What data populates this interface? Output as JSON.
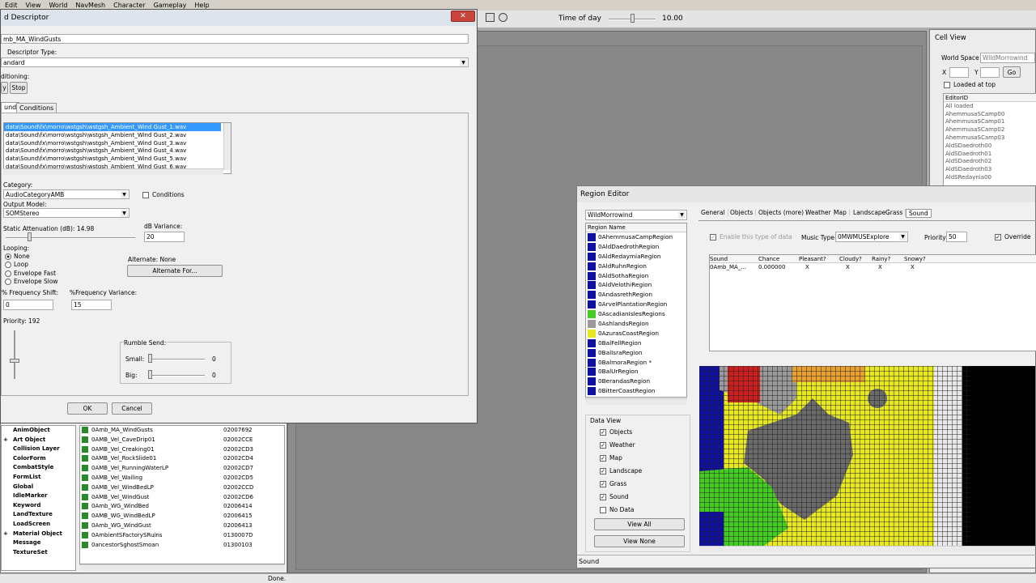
{
  "menu": [
    "Edit",
    "View",
    "World",
    "NavMesh",
    "Character",
    "Gameplay",
    "Help"
  ],
  "toolbar": {
    "time_label": "Time of day",
    "time_value": "10.00"
  },
  "descriptor": {
    "title": "d Descriptor",
    "id_value": "mb_MA_WindGusts",
    "type_label": "Descriptor Type:",
    "type_value": "andard",
    "positioning_label": "ditioning:",
    "play_label": "y",
    "stop_label": "Stop",
    "tabs": [
      "und",
      "Conditions"
    ],
    "files": [
      "data\\Sound\\fx\\morro\\wstgsh\\wstgsh_Ambient_Wind Gust_1.wav",
      "data\\Sound\\fx\\morro\\wstgsh\\wstgsh_Ambient_Wind Gust_2.wav",
      "data\\Sound\\fx\\morro\\wstgsh\\wstgsh_Ambient_Wind Gust_3.wav",
      "data\\Sound\\fx\\morro\\wstgsh\\wstgsh_Ambient_Wind Gust_4.wav",
      "data\\Sound\\fx\\morro\\wstgsh\\wstgsh_Ambient_Wind Gust_5.wav",
      "data\\Sound\\fx\\morro\\wstgsh\\wstgsh_Ambient_Wind Gust_6.wav"
    ],
    "category_label": "Category:",
    "category_value": "AudioCategoryAMB",
    "conditions_label": "Conditions",
    "output_label": "Output Model:",
    "output_value": "SOMStereo",
    "static_att_label": "Static Attenuation (dB): 14.98",
    "static_att_value": 0.18,
    "variance_label": "dB Variance:",
    "variance_value": "20",
    "looping_label": "Looping:",
    "loop_options": [
      "None",
      "Loop",
      "Envelope Fast",
      "Envelope Slow"
    ],
    "loop_selected": 0,
    "alternate_label": "Alternate:  None",
    "alternate_btn": "Alternate For...",
    "freq_shift_label": "% Frequency Shift:",
    "freq_shift_value": "0",
    "freq_var_label": "%Frequency Variance:",
    "freq_var_value": "15",
    "priority_label": "Priority:  192",
    "rumble_label": "Rumble Send:",
    "small_label": "Small:",
    "small_value": "0",
    "big_label": "Big:",
    "big_value": "0",
    "ok": "OK",
    "cancel": "Cancel"
  },
  "object_tree": [
    "AnimObject",
    "Art Object",
    "Collision Layer",
    "ColorForm",
    "CombatStyle",
    "FormList",
    "Global",
    "IdleMarker",
    "Keyword",
    "LandTexture",
    "LoadScreen",
    "Material Object",
    "Message",
    "TextureSet"
  ],
  "object_list": [
    {
      "name": "0Amb_MA_WindGusts",
      "id": "02007692"
    },
    {
      "name": "0AMB_Vel_CaveDrip01",
      "id": "02002CCE"
    },
    {
      "name": "0AMB_Vel_Creaking01",
      "id": "02002CD3"
    },
    {
      "name": "0AMB_Vel_RockSlide01",
      "id": "02002CD4"
    },
    {
      "name": "0AMB_Vel_RunningWaterLP",
      "id": "02002CD7"
    },
    {
      "name": "0AMB_Vel_Wailing",
      "id": "02002CD5"
    },
    {
      "name": "0AMB_Vel_WindBedLP",
      "id": "02002CCD"
    },
    {
      "name": "0AMB_Vel_WindGust",
      "id": "02002CD6"
    },
    {
      "name": "0Amb_WG_WindBed",
      "id": "02006414"
    },
    {
      "name": "0AMB_WG_WindBedLP",
      "id": "02006415"
    },
    {
      "name": "0Amb_WG_WindGust",
      "id": "02006413"
    },
    {
      "name": "0AmbientSFactorySRuins",
      "id": "0130007D"
    },
    {
      "name": "0ancestorSghostSmoan",
      "id": "01300103"
    }
  ],
  "status": {
    "done": "Done."
  },
  "cell_view": {
    "title": "Cell View",
    "world_space_label": "World Space",
    "world_space_value": "WildMorrowind",
    "x_label": "X",
    "y_label": "Y",
    "go": "Go",
    "loaded_label": "Loaded at top",
    "editor_header": "EditorID",
    "cells": [
      "All loaded",
      "AhemmusaSCamp00",
      "AhemmusaSCamp01",
      "AhemmusaSCamp02",
      "AhemmusaSCamp03",
      "AldSDaedroth00",
      "AldSDaedroth01",
      "AldSDaedroth02",
      "AldSDaedroth03",
      "AldSRedaynia00"
    ]
  },
  "region_editor": {
    "title": "Region Editor",
    "world_value": "WildMorrowind",
    "tabs": [
      "General",
      "Objects",
      "Objects (more)",
      "Weather",
      "Map",
      "Landscape",
      "Grass",
      "Sound"
    ],
    "region_header": "Region Name",
    "regions": [
      {
        "name": "0AhemmusaCampRegion",
        "color": "#1010a0"
      },
      {
        "name": "0AldDaedrothRegion",
        "color": "#1010a0"
      },
      {
        "name": "0AldRedaymiaRegion",
        "color": "#1010a0"
      },
      {
        "name": "0AldRuhnRegion",
        "color": "#1010a0"
      },
      {
        "name": "0AldSothaRegion",
        "color": "#1010a0"
      },
      {
        "name": "0AldVelothiRegion",
        "color": "#1010a0"
      },
      {
        "name": "0AndasrethRegion",
        "color": "#1010a0"
      },
      {
        "name": "0ArvelPlantationRegion",
        "color": "#1010a0"
      },
      {
        "name": "0AscadianIslesRegions",
        "color": "#44cc22"
      },
      {
        "name": "0AshlandsRegion",
        "color": "#9a9a9a"
      },
      {
        "name": "0AzurasCoastRegion",
        "color": "#e8e820"
      },
      {
        "name": "0BalFellRegion",
        "color": "#1010a0"
      },
      {
        "name": "0BalIsraRegion",
        "color": "#1010a0"
      },
      {
        "name": "0BalmoraRegion *",
        "color": "#1010a0"
      },
      {
        "name": "0BalUrRegion",
        "color": "#1010a0"
      },
      {
        "name": "0BerandasRegion",
        "color": "#1010a0"
      },
      {
        "name": "0BitterCoastRegion",
        "color": "#1010a0"
      }
    ],
    "enable_label": "Enable this type of data",
    "music_label": "Music Type",
    "music_value": "0MWMUSExplore",
    "priority_label": "Priority:",
    "priority_value": "50",
    "override_label": "Override",
    "table_headers": [
      "Sound",
      "Chance",
      "Pleasant?",
      "Cloudy?",
      "Rainy?",
      "Snowy?"
    ],
    "table_rows": [
      [
        "0Amb_MA_...",
        "0.000000",
        "X",
        "X",
        "X",
        "X"
      ]
    ],
    "data_view_label": "Data View",
    "data_view": [
      "Objects",
      "Weather",
      "Map",
      "Landscape",
      "Grass",
      "Sound",
      "No Data"
    ],
    "data_view_checked": [
      true,
      true,
      true,
      true,
      true,
      true,
      false
    ],
    "view_all": "View All",
    "view_none": "View None",
    "status": "Sound"
  },
  "colors": {
    "blue": "#1010a0",
    "green": "#44cc22",
    "gray": "#7a7a7a",
    "yellow": "#e8e820",
    "red": "#cc2020",
    "white": "#e8e8e8",
    "black": "#000000"
  }
}
